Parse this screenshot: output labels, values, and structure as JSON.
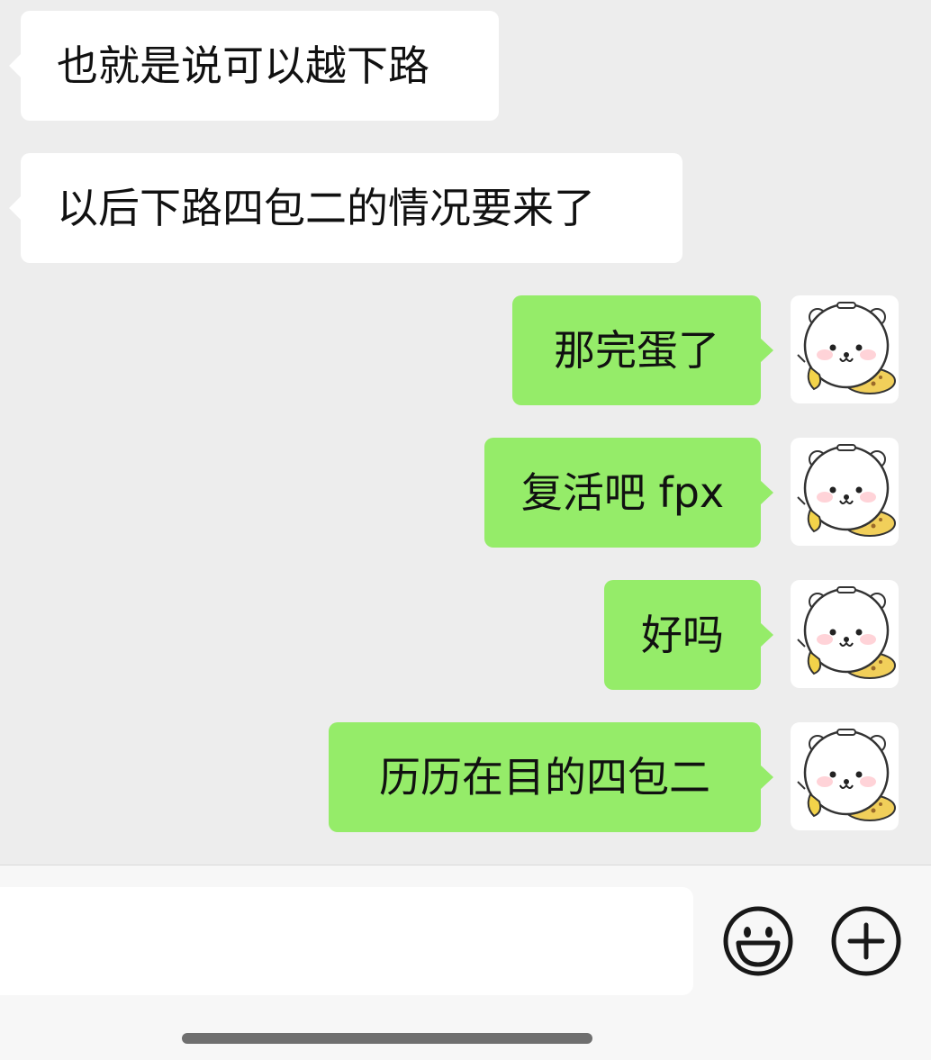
{
  "messages": [
    {
      "side": "in",
      "text": "也就是说可以越下路"
    },
    {
      "side": "in",
      "text": "以后下路四包二的情况要来了"
    },
    {
      "side": "out",
      "text": "那完蛋了"
    },
    {
      "side": "out",
      "text": "复活吧 fpx"
    },
    {
      "side": "out",
      "text": "好吗"
    },
    {
      "side": "out",
      "text": "历历在目的四包二"
    }
  ],
  "input": {
    "value": "",
    "placeholder": ""
  },
  "colors": {
    "background": "#ededed",
    "incoming_bubble": "#ffffff",
    "outgoing_bubble": "#95ec69",
    "input_bar": "#f7f7f7"
  },
  "icons": {
    "avatar": "bear-avatar-icon",
    "emoji": "smiley-face-icon",
    "more": "plus-circle-icon"
  }
}
